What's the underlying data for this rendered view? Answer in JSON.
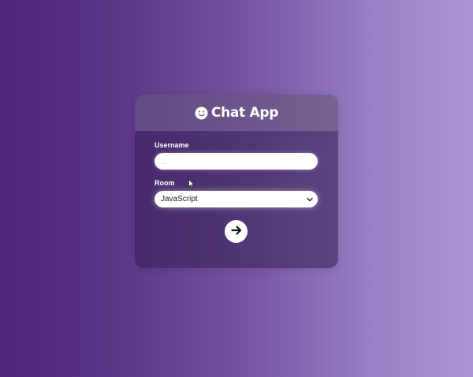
{
  "header": {
    "title": "Chat App",
    "icon": "smiley-icon"
  },
  "form": {
    "username_label": "Username",
    "username_placeholder": "...",
    "username_value": "",
    "room_label": "Room",
    "room_selected": "JavaScript",
    "submit_icon": "arrow-right-icon"
  },
  "colors": {
    "background_start": "#4f257a",
    "background_end": "#ac94d4",
    "button": "#ffffff"
  }
}
